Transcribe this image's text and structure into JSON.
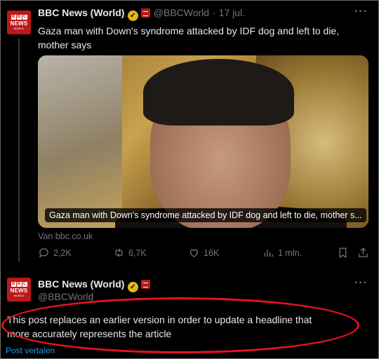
{
  "tweet1": {
    "author_name": "BBC News (World)",
    "handle": "@BBCWorld",
    "separator": "·",
    "date": "17 jul.",
    "more_label": "···",
    "text": "Gaza man with Down's syndrome attacked by IDF dog and left to die, mother says",
    "media_caption": "Gaza man with Down's syndrome attacked by IDF dog and left to die, mother s...",
    "source": "Van bbc.co.uk",
    "stats": {
      "replies": "2,2K",
      "reposts": "6,7K",
      "likes": "16K",
      "views": "1 mln."
    }
  },
  "tweet2": {
    "author_name": "BBC News (World)",
    "handle": "@BBCWorld",
    "more_label": "···",
    "text_line1": "This post replaces an earlier version in order to update a headline that",
    "text_line2": "more accurately represents the article",
    "translate_label": "Post vertalen"
  },
  "avatar": {
    "blocks": [
      "B",
      "B",
      "C"
    ],
    "label": "NEWS",
    "sublabel": "WORLD"
  },
  "colors": {
    "background": "#000000",
    "text": "#e7e9ea",
    "muted": "#71767b",
    "bbc_red": "#bb1919",
    "verified_gold": "#e2b719",
    "highlight_red": "#e5131d",
    "link_blue": "#1d9bf0"
  },
  "icons": [
    "reply-icon",
    "repost-icon",
    "like-icon",
    "views-icon",
    "bookmark-icon",
    "share-icon",
    "verified-badge-icon",
    "affiliate-badge-icon"
  ]
}
